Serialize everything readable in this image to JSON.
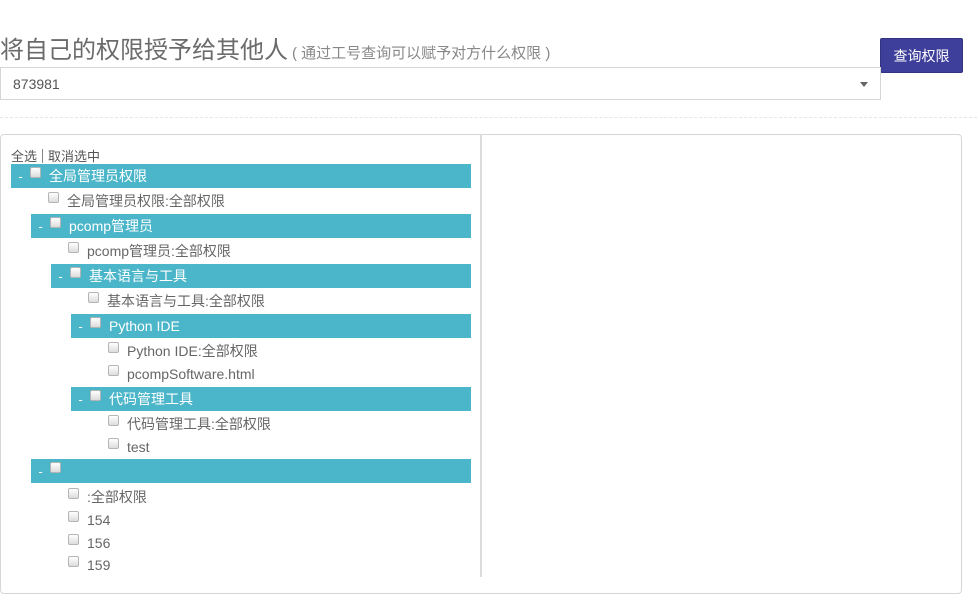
{
  "header": {
    "title": "将自己的权限授予给其他人",
    "subtitle": "( 通过工号查询可以赋予对方什么权限 )",
    "query_button": "查询权限"
  },
  "user_select": {
    "value": "873981"
  },
  "tree_actions": {
    "select_all": "全选",
    "deselect": "取消选中"
  },
  "tree": {
    "g1": "全局管理员权限",
    "g1_l1": "全局管理员权限:全部权限",
    "g2": "pcomp管理员",
    "g2_l1": "pcomp管理员:全部权限",
    "g3": "基本语言与工具",
    "g3_l1": "基本语言与工具:全部权限",
    "g4": "Python IDE",
    "g4_l1": "Python IDE:全部权限",
    "g4_l2": "pcompSoftware.html",
    "g5": "代码管理工具",
    "g5_l1": "代码管理工具:全部权限",
    "g5_l2": "test",
    "g6": "",
    "g6_l1": ":全部权限",
    "g6_l2": "154",
    "g6_l3": "156",
    "g6_l4": "159",
    "toggle_symbol": "-"
  }
}
